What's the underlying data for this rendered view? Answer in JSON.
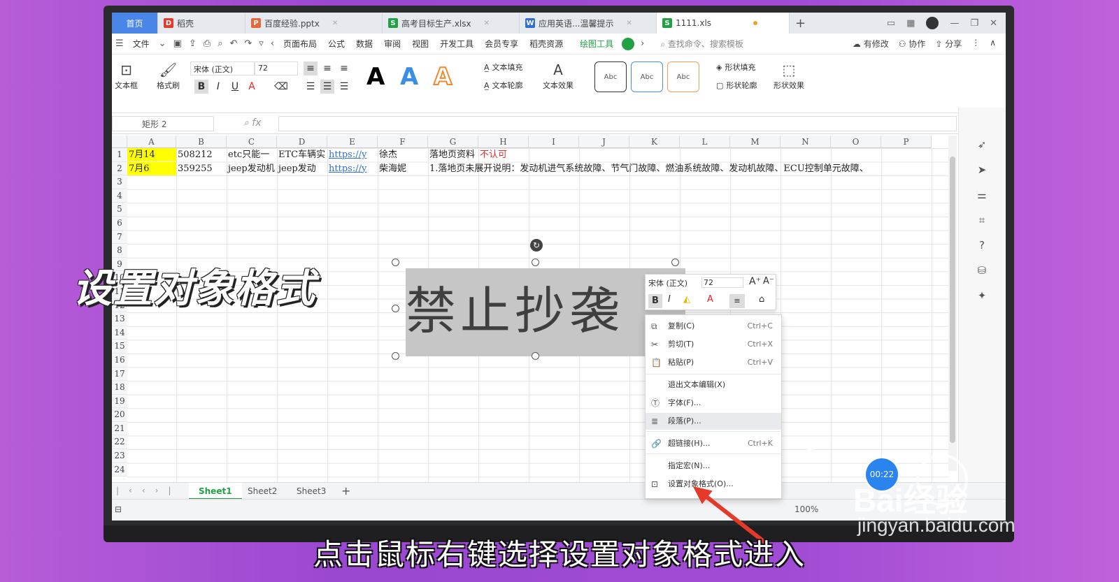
{
  "tabs": [
    {
      "label": "首页",
      "type": "home"
    },
    {
      "label": "稻壳",
      "icon": "docer-icon",
      "color": "#e23b2e"
    },
    {
      "label": "百度经验.pptx",
      "icon": "ppt-icon",
      "color": "#e8663a"
    },
    {
      "label": "高考目标生产.xlsx",
      "icon": "xls-icon",
      "color": "#22a046"
    },
    {
      "label": "应用英语...温馨提示",
      "icon": "doc-icon",
      "color": "#2f6fd6"
    },
    {
      "label": "1111.xls",
      "icon": "xls-icon",
      "color": "#22a046"
    }
  ],
  "menu": {
    "file": "文件",
    "items": [
      "页面布局",
      "公式",
      "数据",
      "审阅",
      "视图",
      "开发工具",
      "会员专享",
      "稻壳资源"
    ],
    "active_tool": "绘图工具",
    "search_placeholder": "查找命令、搜索模板",
    "right": [
      "有修改",
      "协作",
      "分享"
    ]
  },
  "ribbon": {
    "textbox": "文本框",
    "format_painter": "格式刷",
    "font_name": "宋体 (正文)",
    "font_size": "72",
    "text_fill": "文本填充",
    "text_outline": "文本轮廓",
    "text_effect": "文本效果",
    "style_sample": "Abc",
    "shape_fill": "形状填充",
    "shape_outline": "形状轮廓",
    "shape_effect": "形状效果"
  },
  "formula": {
    "namebox": "矩形 2",
    "fx": "fx"
  },
  "columns": [
    "A",
    "B",
    "C",
    "D",
    "E",
    "F",
    "G",
    "H",
    "I",
    "J",
    "K",
    "L",
    "M",
    "N",
    "O",
    "P"
  ],
  "rows": [
    "1",
    "2",
    "3",
    "4",
    "5",
    "6",
    "7",
    "8",
    "9",
    "10",
    "11",
    "12",
    "13",
    "14",
    "15",
    "16",
    "17",
    "18",
    "19",
    "20",
    "21",
    "22",
    "23",
    "24"
  ],
  "cells": {
    "r1": {
      "A": "7月14",
      "B": "508212",
      "C": "etc只能一",
      "D": "ETC车辆实",
      "E": "https://y",
      "F": "徐杰",
      "G": "落地页资料",
      "H": "不认可"
    },
    "r2": {
      "A": "7月6",
      "B": "359255",
      "C": "jeep发动机",
      "D": "jeep发动",
      "E": "https://y",
      "F": "柴海妮",
      "G": "1.落地页未展开说明：发动机进气系统故障、节气门故障、燃油系统故障、发动机故障、ECU控制单元故障、"
    }
  },
  "shape_text": "禁止抄袭",
  "minitoolbar": {
    "font": "宋体 (正文)",
    "size": "72"
  },
  "context_menu": [
    {
      "label": "复制(C)",
      "shortcut": "Ctrl+C",
      "icon": "copy-icon"
    },
    {
      "label": "剪切(T)",
      "shortcut": "Ctrl+X",
      "icon": "scissors-icon"
    },
    {
      "label": "粘贴(P)",
      "shortcut": "Ctrl+V",
      "icon": "paste-icon"
    },
    {
      "label": "退出文本编辑(X)",
      "shortcut": "",
      "icon": ""
    },
    {
      "label": "字体(F)...",
      "shortcut": "",
      "icon": "font-icon"
    },
    {
      "label": "段落(P)...",
      "shortcut": "",
      "icon": "paragraph-icon"
    },
    {
      "label": "超链接(H)...",
      "shortcut": "Ctrl+K",
      "icon": "link-icon"
    },
    {
      "label": "指定宏(N)...",
      "shortcut": "",
      "icon": ""
    },
    {
      "label": "设置对象格式(O)...",
      "shortcut": "",
      "icon": "format-object-icon"
    }
  ],
  "sheets": [
    "Sheet1",
    "Sheet2",
    "Sheet3"
  ],
  "zoom": "100%",
  "timer": "00:22",
  "overlay_title": "设置对象格式",
  "caption": "点击鼠标右键选择设置对象格式进入",
  "watermark": {
    "brand": "Bai经验",
    "url": "jingyan.baidu.com"
  }
}
